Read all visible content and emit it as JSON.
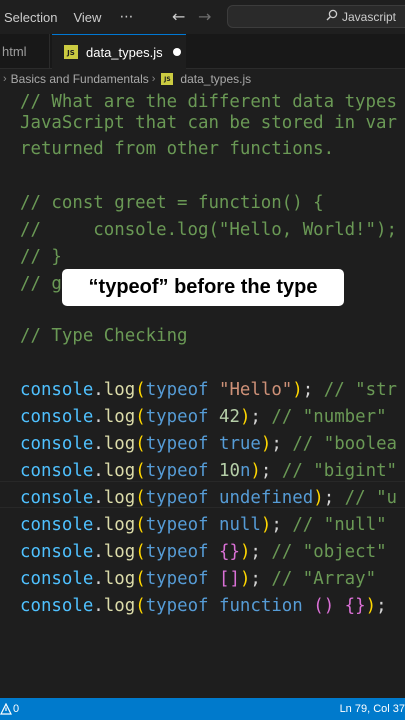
{
  "menubar": {
    "items": [
      "Selection",
      "View"
    ],
    "more_icon": "ellipsis-icon",
    "back_icon": "arrow-left-icon",
    "forward_icon": "arrow-right-icon",
    "search_text": "Javascript"
  },
  "tabs": {
    "prev_tab_label": "html",
    "active_tab_label": "data_types.js",
    "js_badge": "JS"
  },
  "breadcrumb": {
    "folder": "Basics and Fundamentals",
    "file": "data_types.js"
  },
  "editor": {
    "comment_lines": [
      "// What are the different data types",
      "JavaScript that can be stored in var",
      "returned from other functions.",
      "// const greet = function() {",
      "//     console.log(\"Hello, World!\");",
      "// }",
      "// g",
      "// Type Checking"
    ],
    "log_lines": [
      {
        "arg": "\"Hello\"",
        "arg_kind": "str",
        "rest": "); ",
        "comment": "// \"str"
      },
      {
        "arg": "42",
        "arg_kind": "num",
        "rest": "); ",
        "comment": "// \"number\""
      },
      {
        "arg": "true",
        "arg_kind": "kw",
        "rest": "); ",
        "comment": "// \"boolea"
      },
      {
        "arg": "10n",
        "arg_kind": "bigint",
        "rest": "); ",
        "comment": "// \"bigint\""
      },
      {
        "arg": "undefined",
        "arg_kind": "kw",
        "rest": "); ",
        "comment": "// \"u"
      },
      {
        "arg": "null",
        "arg_kind": "kw",
        "rest": "); ",
        "comment": "// \"null\""
      },
      {
        "arg": "{}",
        "arg_kind": "curly",
        "rest": "); ",
        "comment": "// \"object\""
      },
      {
        "arg": "[]",
        "arg_kind": "curly",
        "rest": "); ",
        "comment": "// \"Array\""
      },
      {
        "arg": "function () {}",
        "arg_kind": "func",
        "rest": ");",
        "comment": ""
      }
    ],
    "tokens": {
      "console": "console",
      "log": "log",
      "typeof": "typeof"
    }
  },
  "caption": "“typeof” before the type",
  "statusbar": {
    "left_text": "0",
    "position": "Ln 79, Col 37"
  },
  "colors": {
    "status_bar": "#007acc",
    "comment": "#6a9955",
    "keyword": "#569cd6",
    "string": "#ce9178",
    "function": "#dcdcaa",
    "object": "#4fc1ff"
  }
}
